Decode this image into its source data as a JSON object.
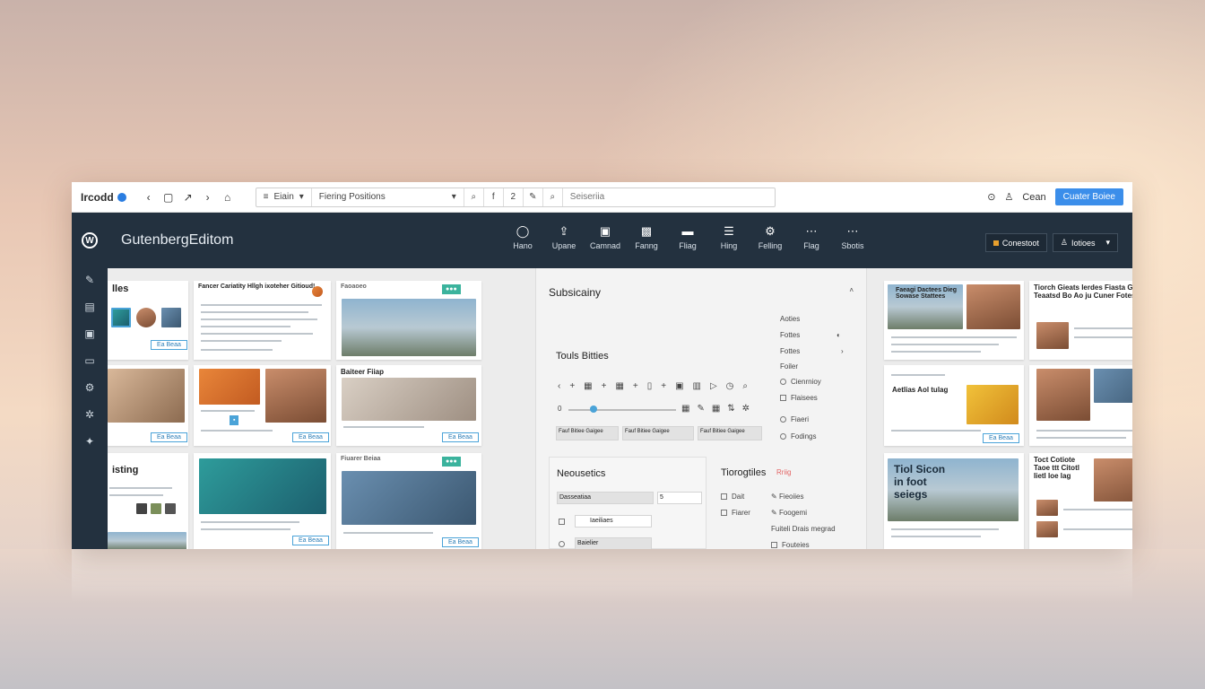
{
  "browser": {
    "brand": "Ircodd",
    "addr_seg1": "Eiain",
    "addr_seg2": "Fiering Positions",
    "search_placeholder": "Seiseriia",
    "link": "Cean",
    "primary_button": "Cuater Boiee"
  },
  "editor": {
    "title": "GutenbergEditom",
    "tools": [
      {
        "label": "Hano",
        "icon": "circle-icon"
      },
      {
        "label": "Upane",
        "icon": "upload-icon"
      },
      {
        "label": "Camnad",
        "icon": "document-icon"
      },
      {
        "label": "Fanng",
        "icon": "image-icon"
      },
      {
        "label": "Fliag",
        "icon": "block-icon"
      },
      {
        "label": "Hing",
        "icon": "list-icon"
      },
      {
        "label": "Felling",
        "icon": "gear-icon"
      },
      {
        "label": "Flag",
        "icon": "more-icon"
      },
      {
        "label": "Sbotis",
        "icon": "more-icon"
      }
    ],
    "right_button": "Conestoot",
    "right_link": "Iotioes"
  },
  "panel": {
    "title": "Subsicainy",
    "options": [
      "Aoties",
      "Fottes",
      "Fottes",
      "Foiler"
    ],
    "radios": [
      "Cienrnioy",
      "Flaisees",
      "Fiaeri",
      "Fodings"
    ],
    "tools_title": "Touls Bitties",
    "cells": [
      "Fauf Bitiee Gaigee",
      "Fauf Bitiee Gaigee",
      "Fauf Bitiee Gaigee"
    ],
    "sec2_title": "Neousetics",
    "sec2_field": "Dasseatiaa",
    "sec2_value": "5",
    "sec2_select": "Iaeiliaes",
    "sec2_select2": "Baielier",
    "sec3_title": "Tiorogtiles",
    "sec3_badge": "Rriig",
    "sec3_items": [
      "Dait",
      "Fiarer"
    ],
    "sec3_links": [
      "Fieoiies",
      "Foogemi",
      "Fuiteli Drais megrad",
      "Fouteies"
    ]
  },
  "cards_left": {
    "c1_title": "lles",
    "c4_title": "isting",
    "btn": "Ea Beaa"
  },
  "cards_mid": {
    "c1_header": "Fancer Cariatity Hllgh ixoteher Gitioud!",
    "c2_header": "Baiteer Fiiap",
    "c3_tag": "Faoaoeo",
    "btn": "Ea Beaa",
    "c4_title": "Fiuarer Beiaa"
  },
  "cards_right": {
    "r1_title": "Faeagi Dactees Dieg Sowase Stattees",
    "r2_title": "Tiorch Gieats lerdes Fiasta Gwerac Teaatsd Bo Ao ju Cuner Fotes",
    "r3_title": "Aetlias Aol tulag",
    "r5_title": "Tiol Sicon in foot seiegs",
    "r6_title": "Toct Cotiote Taoe ttt Citotl Iietl Ioe lag",
    "btn": "Ea Beaa"
  }
}
